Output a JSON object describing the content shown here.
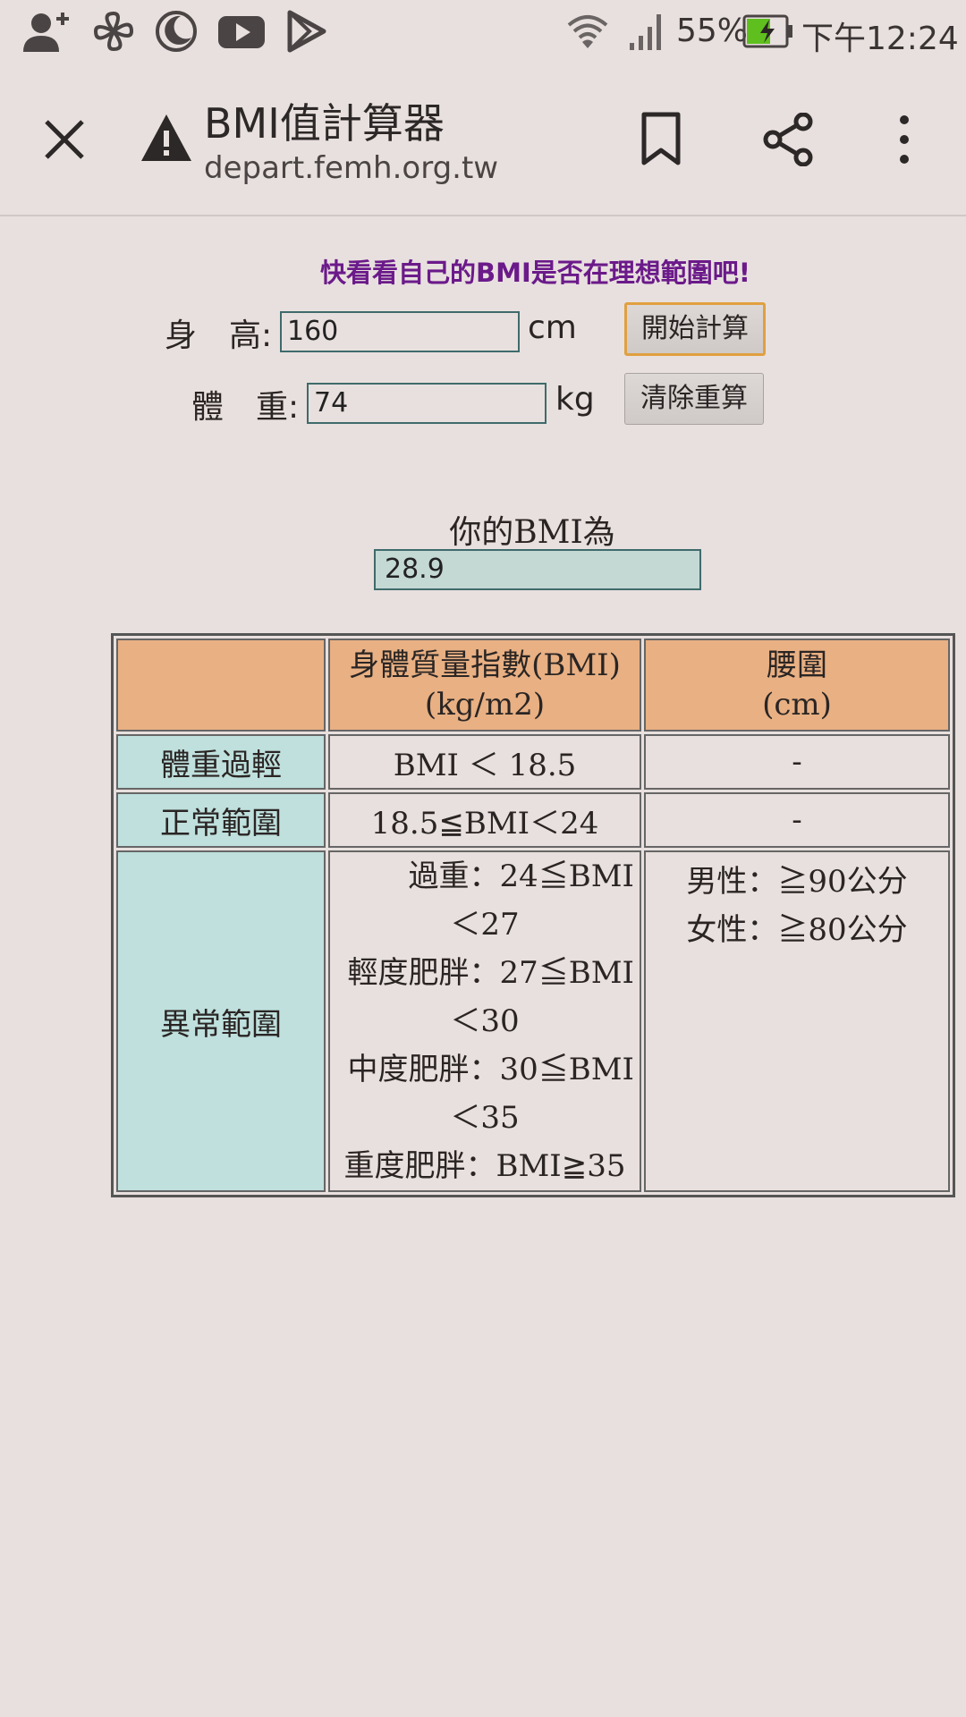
{
  "status_bar": {
    "battery": "55%",
    "time": "下午12:24"
  },
  "toolbar": {
    "title": "BMI值計算器",
    "url": "depart.femh.org.tw"
  },
  "form": {
    "tagline": "快看看自己的BMI是否在理想範圍吧!",
    "height_label": "身　高:",
    "height_value": "160",
    "height_unit": "cm",
    "weight_label": "體　重:",
    "weight_value": "74",
    "weight_unit": "kg",
    "calc_button": "開始計算",
    "clear_button": "清除重算"
  },
  "result": {
    "label": "你的BMI為",
    "value": "28.9"
  },
  "table": {
    "header_bmi_line1": "身體質量指數(BMI)",
    "header_bmi_line2": "(kg/m2)",
    "header_waist_line1": "腰圍",
    "header_waist_line2": "(cm)",
    "rows": [
      {
        "category": "體重過輕",
        "bmi": "BMI ＜ 18.5",
        "waist": "-"
      },
      {
        "category": "正常範圍",
        "bmi": "18.5≦BMI＜24",
        "waist": "-"
      }
    ],
    "abnormal": {
      "category": "異常範圍",
      "bmi_lines": [
        "過重：24≦BMI",
        "＜27",
        "輕度肥胖：27≦BMI",
        "＜30",
        "中度肥胖：30≦BMI",
        "＜35",
        "重度肥胖：BMI≧35"
      ],
      "waist_male": "男性：≧90公分",
      "waist_female": "女性：≧80公分"
    }
  },
  "colors": {
    "accent_purple": "#6b1a8a",
    "header_orange": "#e8b083",
    "category_teal": "#bfe0dd",
    "result_fill": "#c4d8d4",
    "battery_green": "#5fbf1e"
  }
}
